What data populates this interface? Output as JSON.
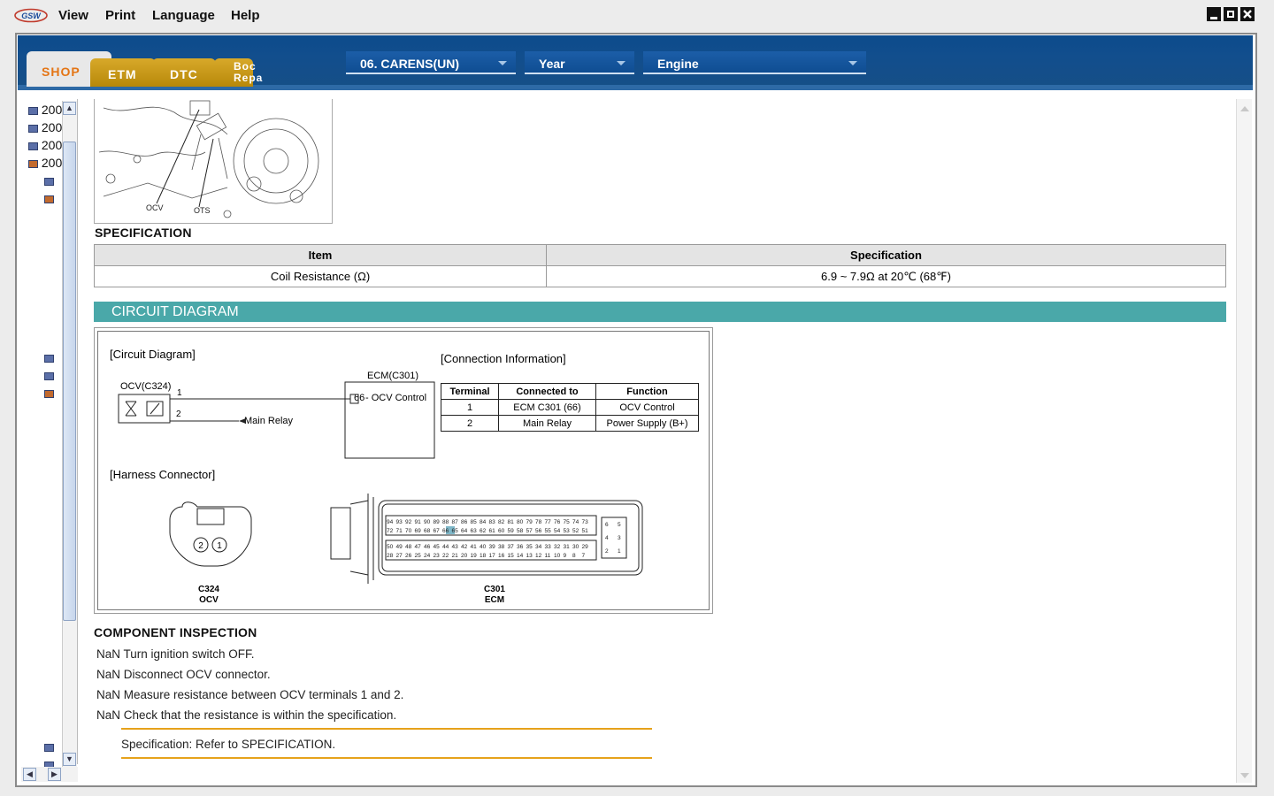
{
  "menubar": {
    "items": [
      "View",
      "Print",
      "Language",
      "Help"
    ],
    "logo": "GSW"
  },
  "tabs": [
    {
      "label": "SHOP",
      "active": true
    },
    {
      "label": "ETM",
      "active": false
    },
    {
      "label": "DTC",
      "active": false
    },
    {
      "label": "Body Repair",
      "line1": "Boc",
      "line2": "Repa",
      "active": false
    }
  ],
  "filters": {
    "model": "06. CARENS(UN)",
    "year": "Year",
    "engine": "Engine"
  },
  "tree": {
    "items": [
      "200",
      "200",
      "200",
      "200"
    ]
  },
  "diagram_labels": {
    "ocv": "OCV",
    "ots": "OTS"
  },
  "specification": {
    "heading": "SPECIFICATION",
    "columns": [
      "Item",
      "Specification"
    ],
    "rows": [
      {
        "item": "Coil Resistance (Ω)",
        "spec": "6.9 ~ 7.9Ω at 20℃ (68℉)"
      }
    ]
  },
  "circuit": {
    "heading": "CIRCUIT DIAGRAM",
    "circuit_title": "[Circuit Diagram]",
    "connection_title": "[Connection Information]",
    "harness_title": "[Harness Connector]",
    "ocv_label": "OCV(C324)",
    "ecm_label": "ECM(C301)",
    "pin1": "1",
    "pin2": "2",
    "ecm_pin": "66",
    "ecm_pin_text": "- OCV Control",
    "main_relay": "Main Relay",
    "conn_table": {
      "columns": [
        "Terminal",
        "Connected to",
        "Function"
      ],
      "rows": [
        [
          "1",
          "ECM C301 (66)",
          "OCV Control"
        ],
        [
          "2",
          "Main Relay",
          "Power Supply (B+)"
        ]
      ]
    },
    "c324": {
      "code": "C324",
      "name": "OCV",
      "pins": [
        "2",
        "1"
      ]
    },
    "c301": {
      "code": "C301",
      "name": "ECM",
      "row1": [
        "94",
        "93",
        "92",
        "91",
        "90",
        "89",
        "88",
        "87",
        "86",
        "85",
        "84",
        "83",
        "82",
        "81",
        "80",
        "79",
        "78",
        "77",
        "76",
        "75",
        "74",
        "73"
      ],
      "row2": [
        "72",
        "71",
        "70",
        "69",
        "68",
        "67",
        "66",
        "65",
        "64",
        "63",
        "62",
        "61",
        "60",
        "59",
        "58",
        "57",
        "56",
        "55",
        "54",
        "53",
        "52",
        "51"
      ],
      "row3": [
        "50",
        "49",
        "48",
        "47",
        "46",
        "45",
        "44",
        "43",
        "42",
        "41",
        "40",
        "39",
        "38",
        "37",
        "36",
        "35",
        "34",
        "33",
        "32",
        "31",
        "30",
        "29"
      ],
      "row4": [
        "28",
        "27",
        "26",
        "25",
        "24",
        "23",
        "22",
        "21",
        "20",
        "19",
        "18",
        "17",
        "16",
        "15",
        "14",
        "13",
        "12",
        "11",
        "10",
        "9",
        "8",
        "7"
      ],
      "side": [
        "6",
        "5",
        "4",
        "3",
        "2",
        "1"
      ],
      "highlight": "66"
    }
  },
  "inspection": {
    "heading": "COMPONENT INSPECTION",
    "steps": [
      "NaN Turn ignition switch OFF.",
      "NaN Disconnect OCV connector.",
      "NaN Measure resistance between OCV terminals 1 and 2.",
      "NaN Check that the resistance is within the specification."
    ],
    "note": "Specification: Refer to SPECIFICATION."
  },
  "colors": {
    "accent_teal": "#4aa8a9",
    "shop_orange": "#e47515",
    "header_blue": "#124e8d",
    "note_rule": "#e6a21b",
    "highlight_pin": "#7fb8c9"
  }
}
